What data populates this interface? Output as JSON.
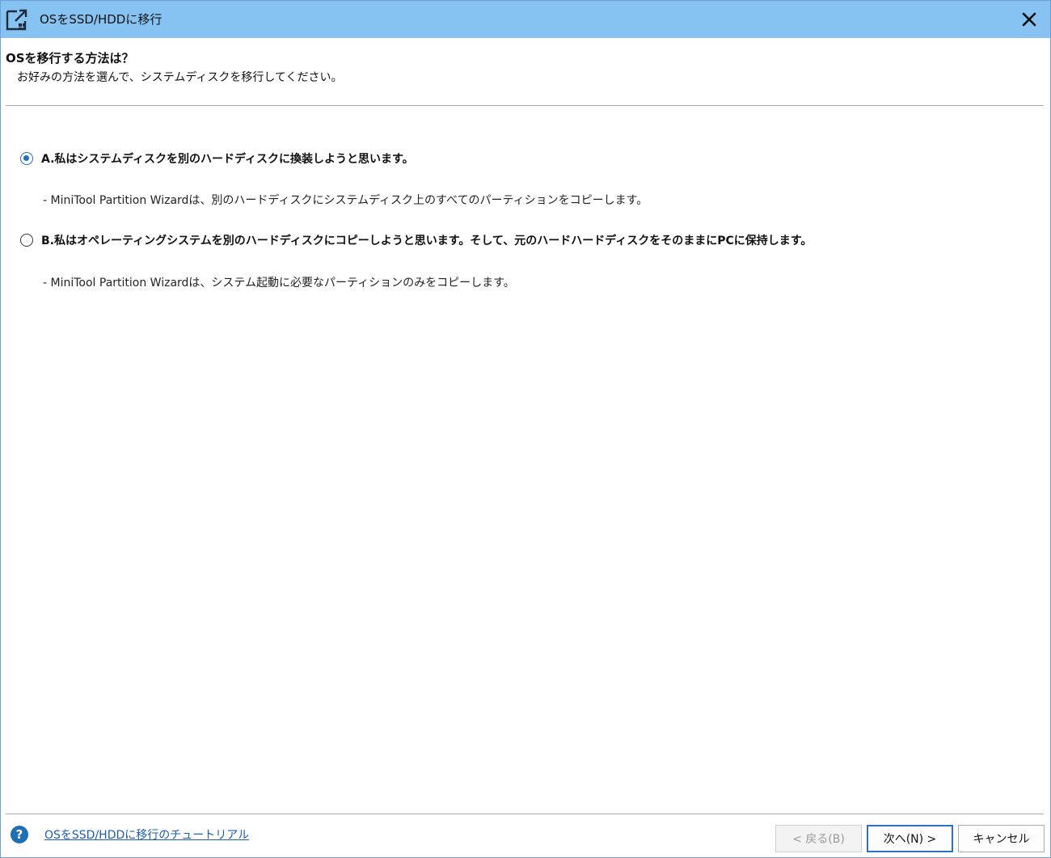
{
  "window": {
    "title": "OSをSSD/HDDに移行",
    "app_icon": "migrate-disk-icon",
    "close_icon": "close-icon"
  },
  "header": {
    "heading": "OSを移行する方法は？",
    "subheading": "お好みの方法を選んで、システムディスクを移行してください。"
  },
  "options": [
    {
      "label": "A.私はシステムディスクを別のハードディスクに換装しようと思います。",
      "description": "- MiniTool Partition Wizardは、別のハードディスクにシステムディスク上のすべてのパーティションをコピーします。",
      "selected": true
    },
    {
      "label": "B.私はオペレーティングシステムを別のハードディスクにコピーしようと思います。そして、元のハードハードディスクをそのままにPCに保持します。",
      "description": "- MiniTool Partition Wizardは、システム起動に必要なパーティションのみをコピーします。",
      "selected": false
    }
  ],
  "footer": {
    "help_icon": "help-icon",
    "help_link": "OSをSSD/HDDに移行のチュートリアル",
    "back_button": "< 戻る(B)",
    "next_button": "次へ(N) >",
    "cancel_button": "キャンセル"
  },
  "colors": {
    "titlebar": "#86c3f2",
    "accent": "#1e6fc7",
    "link": "#1a5fb4"
  }
}
